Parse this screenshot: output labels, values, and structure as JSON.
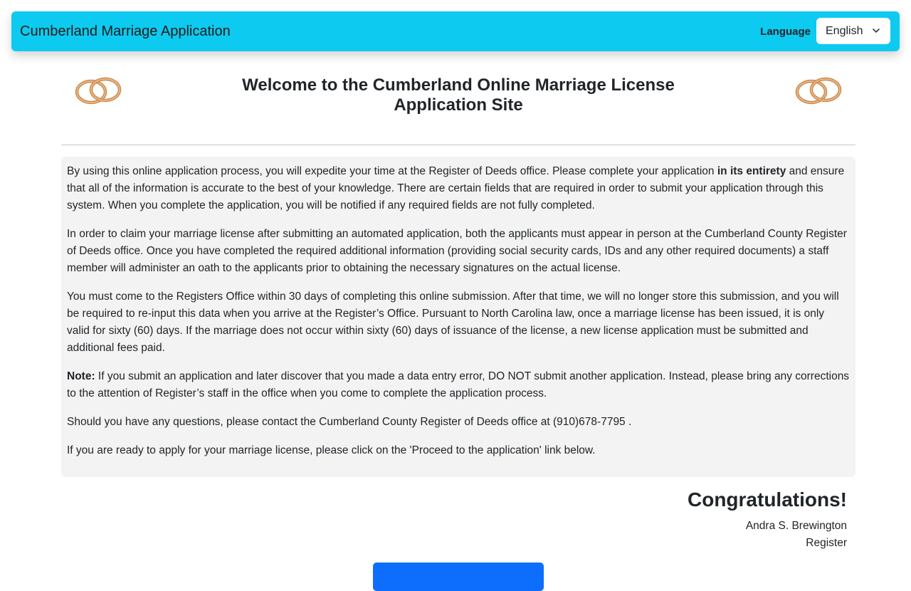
{
  "navbar": {
    "brand": "Cumberland Marriage Application",
    "language_label": "Language",
    "language_selected": "English",
    "color": "#0dcaf0"
  },
  "header": {
    "title": "Welcome to the Cumberland Online Marriage License Application Site",
    "icons": [
      "wedding-rings-icon",
      "wedding-rings-icon"
    ]
  },
  "info": {
    "p1_pre": "By using this online application process, you will expedite your time at the Register of Deeds office. Please complete your application ",
    "p1_bold": "in its entirety",
    "p1_post": " and ensure that all of the information is accurate to the best of your knowledge. There are certain fields that are required in order to submit your application through this system. When you complete the application, you will be notified if any required fields are not fully completed.",
    "p2": "In order to claim your marriage license after submitting an automated application, both the applicants must appear in person at the Cumberland County Register of Deeds office. Once you have completed the required additional information (providing social security cards, IDs and any other required documents) a staff member will administer an oath to the applicants prior to obtaining the necessary signatures on the actual license.",
    "p3": "You must come to the Registers Office within 30 days of completing this online submission. After that time, we will no longer store this submission, and you will be required to re-input this data when you arrive at the Register’s Office. Pursuant to North Carolina law, once a marriage license has been issued, it is only valid for sixty (60) days. If the marriage does not occur within sixty (60) days of issuance of the license, a new license application must be submitted and additional fees paid.",
    "note_label": "Note:",
    "note_text": " If you submit an application and later discover that you made a data entry error, DO NOT submit another application. Instead, please bring any corrections to the attention of Register’s staff in the office when you come to complete the application process.",
    "p5": "Should you have any questions, please contact the Cumberland County Register of Deeds office at (910)678-7795 .",
    "p6": "If you are ready to apply for your marriage license, please click on the 'Proceed to the application' link below."
  },
  "closing": {
    "congrats": "Congratulations!",
    "signer_name": "Andra S. Brewington",
    "signer_title": "Register"
  },
  "proceed_button": {
    "color": "#0d6efd"
  }
}
